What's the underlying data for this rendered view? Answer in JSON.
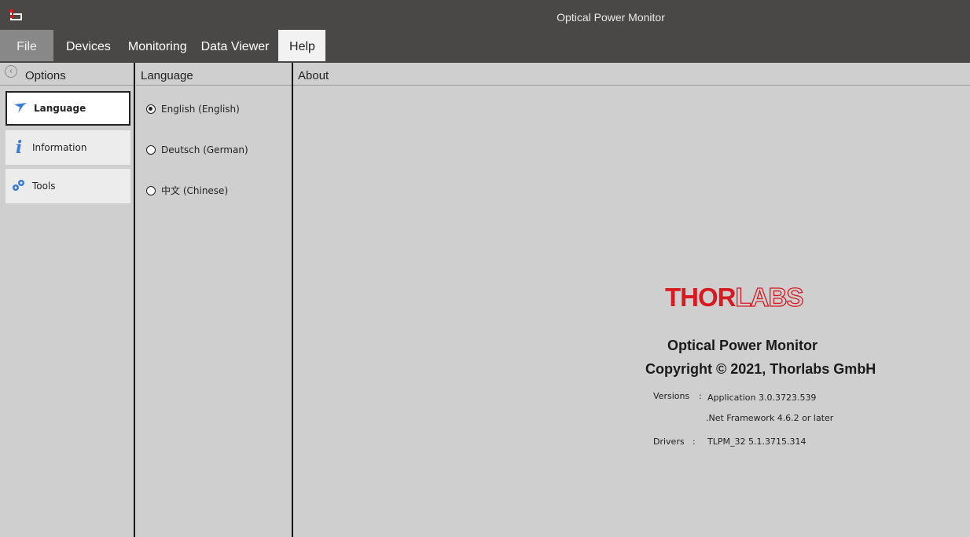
{
  "window": {
    "title": "Optical Power Monitor"
  },
  "menu": {
    "items": [
      "File",
      "Devices",
      "Monitoring",
      "Data Viewer",
      "Help"
    ],
    "selected": "Help"
  },
  "options_panel": {
    "header": "Options",
    "items": [
      {
        "label": "Language",
        "icon": "language-icon",
        "active": true
      },
      {
        "label": "Information",
        "icon": "info-icon",
        "active": false
      },
      {
        "label": "Tools",
        "icon": "tools-icon",
        "active": false
      }
    ]
  },
  "language_panel": {
    "header": "Language",
    "options": [
      {
        "label": "English (English)",
        "checked": true
      },
      {
        "label": "Deutsch (German)",
        "checked": false
      },
      {
        "label": "中文 (Chinese)",
        "checked": false
      }
    ]
  },
  "about_panel": {
    "header": "About",
    "logo": {
      "part1": "THOR",
      "part2": "LABS"
    },
    "app_name": "Optical Power Monitor",
    "copyright": "Copyright © 2021, Thorlabs GmbH",
    "versions_label": "Versions",
    "separator": ":",
    "application_version": "Application 3.0.3723.539",
    "framework": ".Net Framework 4.6.2 or later",
    "drivers_label": "Drivers",
    "drivers_value": "TLPM_32 5.1.3715.314"
  },
  "colors": {
    "titlebar": "#494846",
    "brand_red": "#d71920",
    "background": "#cfcfcf"
  }
}
